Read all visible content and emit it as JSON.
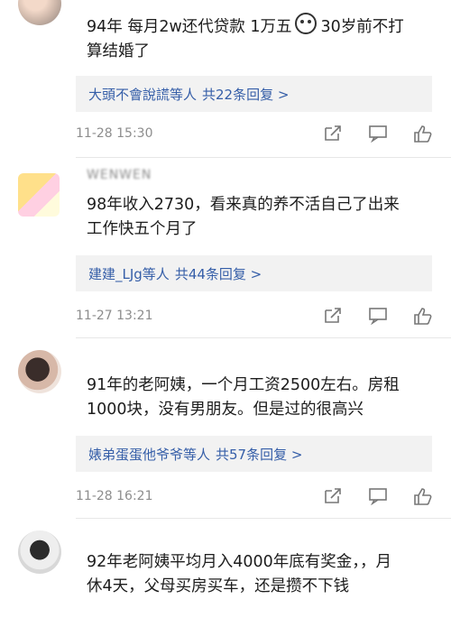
{
  "comments": [
    {
      "username": "",
      "text_line1_a": "94年 每月2w还代贷款 1万五",
      "text_line1_b": "30岁前不打",
      "text_line2": "算结婚了",
      "reply_names": "大頭不會說謊等人",
      "reply_count": "共22条回复 >",
      "timestamp": "11-28 15:30"
    },
    {
      "username": "WENWEN",
      "text_line1": "98年收入2730，看来真的养不活自己了出来",
      "text_line2": "工作快五个月了",
      "reply_names": "建建_LJg等人",
      "reply_count": "共44条回复 >",
      "timestamp": "11-27 13:21"
    },
    {
      "username": "",
      "text_line1": "91年的老阿姨，一个月工资2500左右。房租",
      "text_line2": "1000块，没有男朋友。但是过的很高兴",
      "reply_names": "婊弟蛋蛋他爷爷等人",
      "reply_count": "共57条回复 >",
      "timestamp": "11-28 16:21"
    },
    {
      "username": "",
      "text_line1": "92年老阿姨平均月入4000年底有奖金，，月",
      "text_line2": "休4天，父母买房买车，还是攒不下钱"
    }
  ],
  "icons": {
    "share": "share-icon",
    "comment": "comment-icon",
    "like": "thumbs-up-icon"
  },
  "colors": {
    "reply_link": "#355ea8",
    "meta_gray": "#8d8d8d",
    "reply_bg": "#f2f2f2"
  }
}
